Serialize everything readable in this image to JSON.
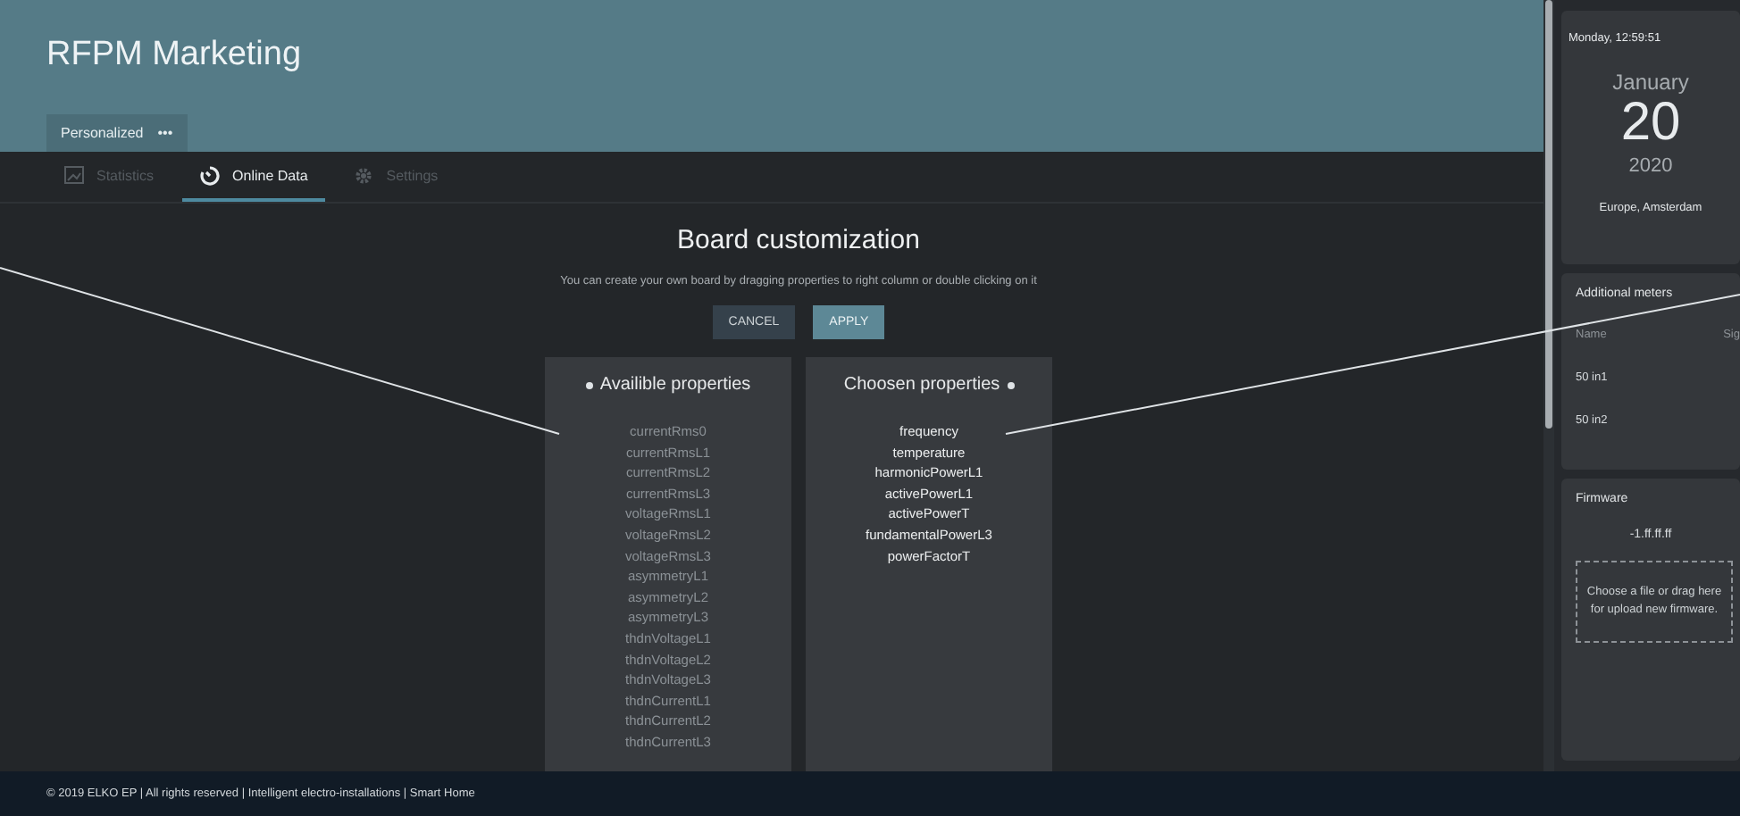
{
  "header": {
    "title": "RFPM Marketing",
    "board_tab": {
      "label": "Personalized",
      "menu": "•••"
    }
  },
  "tabs": [
    {
      "label": "Statistics",
      "selected": false
    },
    {
      "label": "Online Data",
      "selected": true
    },
    {
      "label": "Settings",
      "selected": false
    }
  ],
  "board": {
    "title": "Board customization",
    "description": "You can create your own board by dragging properties to right column or double clicking on it",
    "buttons": [
      {
        "label": "CANCEL",
        "kind": "secondary"
      },
      {
        "label": "APPLY",
        "kind": "primary"
      }
    ],
    "available": {
      "title": "Availible properties",
      "items": [
        "currentRms0",
        "currentRmsL1",
        "currentRmsL2",
        "currentRmsL3",
        "voltageRmsL1",
        "voltageRmsL2",
        "voltageRmsL3",
        "asymmetryL1",
        "asymmetryL2",
        "asymmetryL3",
        "thdnVoltageL1",
        "thdnVoltageL2",
        "thdnVoltageL3",
        "thdnCurrentL1",
        "thdnCurrentL2",
        "thdnCurrentL3"
      ]
    },
    "chosen": {
      "title": "Choosen properties",
      "items": [
        "frequency",
        "temperature",
        "harmonicPowerL1",
        "activePowerL1",
        "activePowerT",
        "fundamentalPowerL3",
        "powerFactorT"
      ]
    }
  },
  "footer": "© 2019 ELKO EP | All rights reserved | Intelligent electro-installations | Smart Home",
  "date_card": {
    "datetime": "Monday, 12:59:51",
    "month": "January",
    "day": "20",
    "year": "2020",
    "timezone": "Europe, Amsterdam"
  },
  "meters": {
    "title": "Additional meters",
    "columns": [
      "Name",
      "Sig"
    ],
    "rows": [
      "50 in1",
      "50 in2"
    ]
  },
  "firmware": {
    "title": "Firmware",
    "version": "-1.ff.ff.ff",
    "dropzone": "Choose a file or drag here for upload new firmware."
  }
}
